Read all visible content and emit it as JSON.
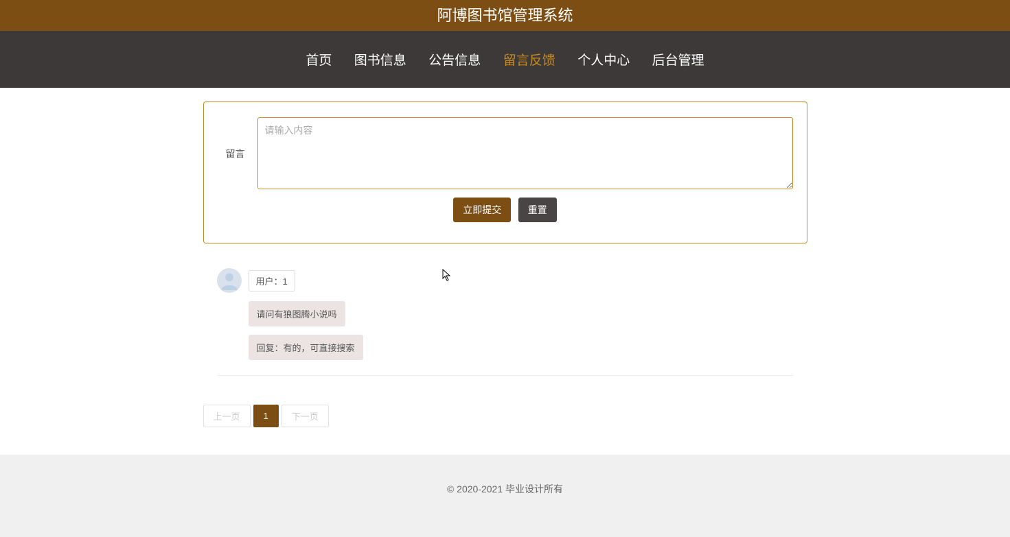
{
  "site_title": "阿博图书馆管理系统",
  "nav": {
    "items": [
      {
        "label": "首页"
      },
      {
        "label": "图书信息"
      },
      {
        "label": "公告信息"
      },
      {
        "label": "留言反馈"
      },
      {
        "label": "个人中心"
      },
      {
        "label": "后台管理"
      }
    ],
    "active_index": 3
  },
  "feedback_form": {
    "label": "留言",
    "placeholder": "请输入内容",
    "submit_label": "立即提交",
    "reset_label": "重置"
  },
  "messages": [
    {
      "user_label": "用户：1",
      "content": "请问有狼图腾小说吗",
      "reply": "回复：有的，可直接搜索"
    }
  ],
  "pagination": {
    "prev_label": "上一页",
    "next_label": "下一页",
    "current_page": "1"
  },
  "footer": {
    "copyright": "© 2020-2021 毕业设计所有"
  }
}
